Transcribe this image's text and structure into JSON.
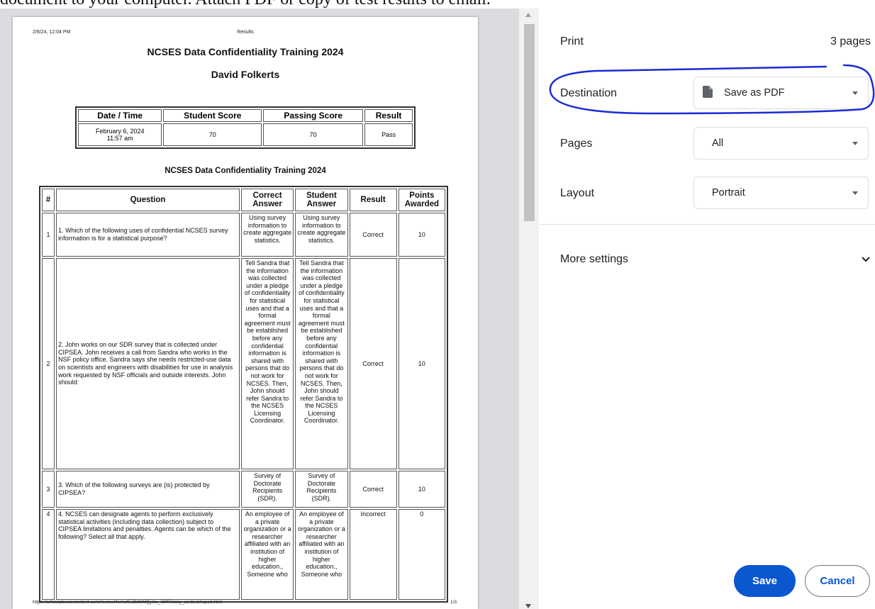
{
  "caption": "document to your computer. Attach PDF or copy of test results to email.",
  "report": {
    "header_date": "2/6/24, 12:04 PM",
    "header_title": "Results",
    "title": "NCSES Data Confidentiality Training 2024",
    "student_name": "David Folkerts",
    "summary": {
      "headers": [
        "Date / Time",
        "Student Score",
        "Passing Score",
        "Result"
      ],
      "date_line1": "February 6, 2024",
      "date_line2": "11:57 am",
      "student_score": "70",
      "passing_score": "70",
      "result": "Pass"
    },
    "subtitle": "NCSES Data Confidentiality Training 2024",
    "questions_headers": {
      "num": "#",
      "question": "Question",
      "correct_answer": "Correct Answer",
      "student_answer": "Student Answer",
      "result": "Result",
      "points": "Points Awarded"
    },
    "questions": [
      {
        "num": "1",
        "question": "1. Which of the following uses of confidential NCSES survey information is for a statistical purpose?",
        "correct_answer": "Using survey information to create aggregate statistics.",
        "student_answer": "Using survey information to create aggregate statistics.",
        "result": "Correct",
        "points": "10"
      },
      {
        "num": "2",
        "question": "2. John works on our SDR survey that is collected under CIPSEA. John receives a call from Sandra who works in the NSF policy office. Sandra says she needs restricted-use data on scientists and engineers with disabilities for use in analysis work requested by NSF officials and outside interests. John should:",
        "correct_answer": "Tell Sandra that the information was collected under a pledge of confidentiality for statistical uses and that a formal agreement must be established before any confidential information is shared with persons that do not work for NCSES. Then, John should refer Sandra to the NCSES Licensing Coordinator.",
        "student_answer": "Tell Sandra that the information was collected under a pledge of confidentiality for statistical uses and that a formal agreement must be established before any confidential information is shared with persons that do not work for NCSES. Then, John should refer Sandra to the NCSES Licensing Coordinator.",
        "result": "Correct",
        "points": "10"
      },
      {
        "num": "3",
        "question": "3. Which of the following surveys are (is) protected by CIPSEA?",
        "correct_answer": "Survey of Doctorate Recipients (SDR).",
        "student_answer": "Survey of Doctorate Recipients (SDR).",
        "result": "Correct",
        "points": "10"
      },
      {
        "num": "4",
        "question": "4. NCSES can designate agents to perform exclusively statistical activities (including data collection) subject to CIPSEA limitations and penalties. Agents can be which of the following? Select all that apply.",
        "correct_answer": "An employee of a private organization or a researcher affiliated with an institution of higher education., Someone who",
        "student_answer": "An employee of a private organization or a researcher affiliated with an institution of higher education., Someone who",
        "result": "Incorrect",
        "points": "0"
      }
    ],
    "footer_url": "https://articulateusercontent.com/review/items/5v2b8zMQyUu_I30R/story_content/report.html",
    "footer_page": "1/3"
  },
  "print_panel": {
    "title": "Print",
    "page_count": "3 pages",
    "destination_label": "Destination",
    "destination_value": "Save as PDF",
    "pages_label": "Pages",
    "pages_value": "All",
    "layout_label": "Layout",
    "layout_value": "Portrait",
    "more_settings": "More settings",
    "save_button": "Save",
    "cancel_button": "Cancel"
  },
  "colors": {
    "accent": "#0b57d0",
    "annotation": "#1a2bd6",
    "correct": "#2e8b2e",
    "incorrect": "#b22222"
  },
  "icons": [
    "document-icon",
    "caret-down-icon",
    "chevron-down-icon",
    "scroll-up-arrow-icon",
    "scroll-down-arrow-icon"
  ]
}
